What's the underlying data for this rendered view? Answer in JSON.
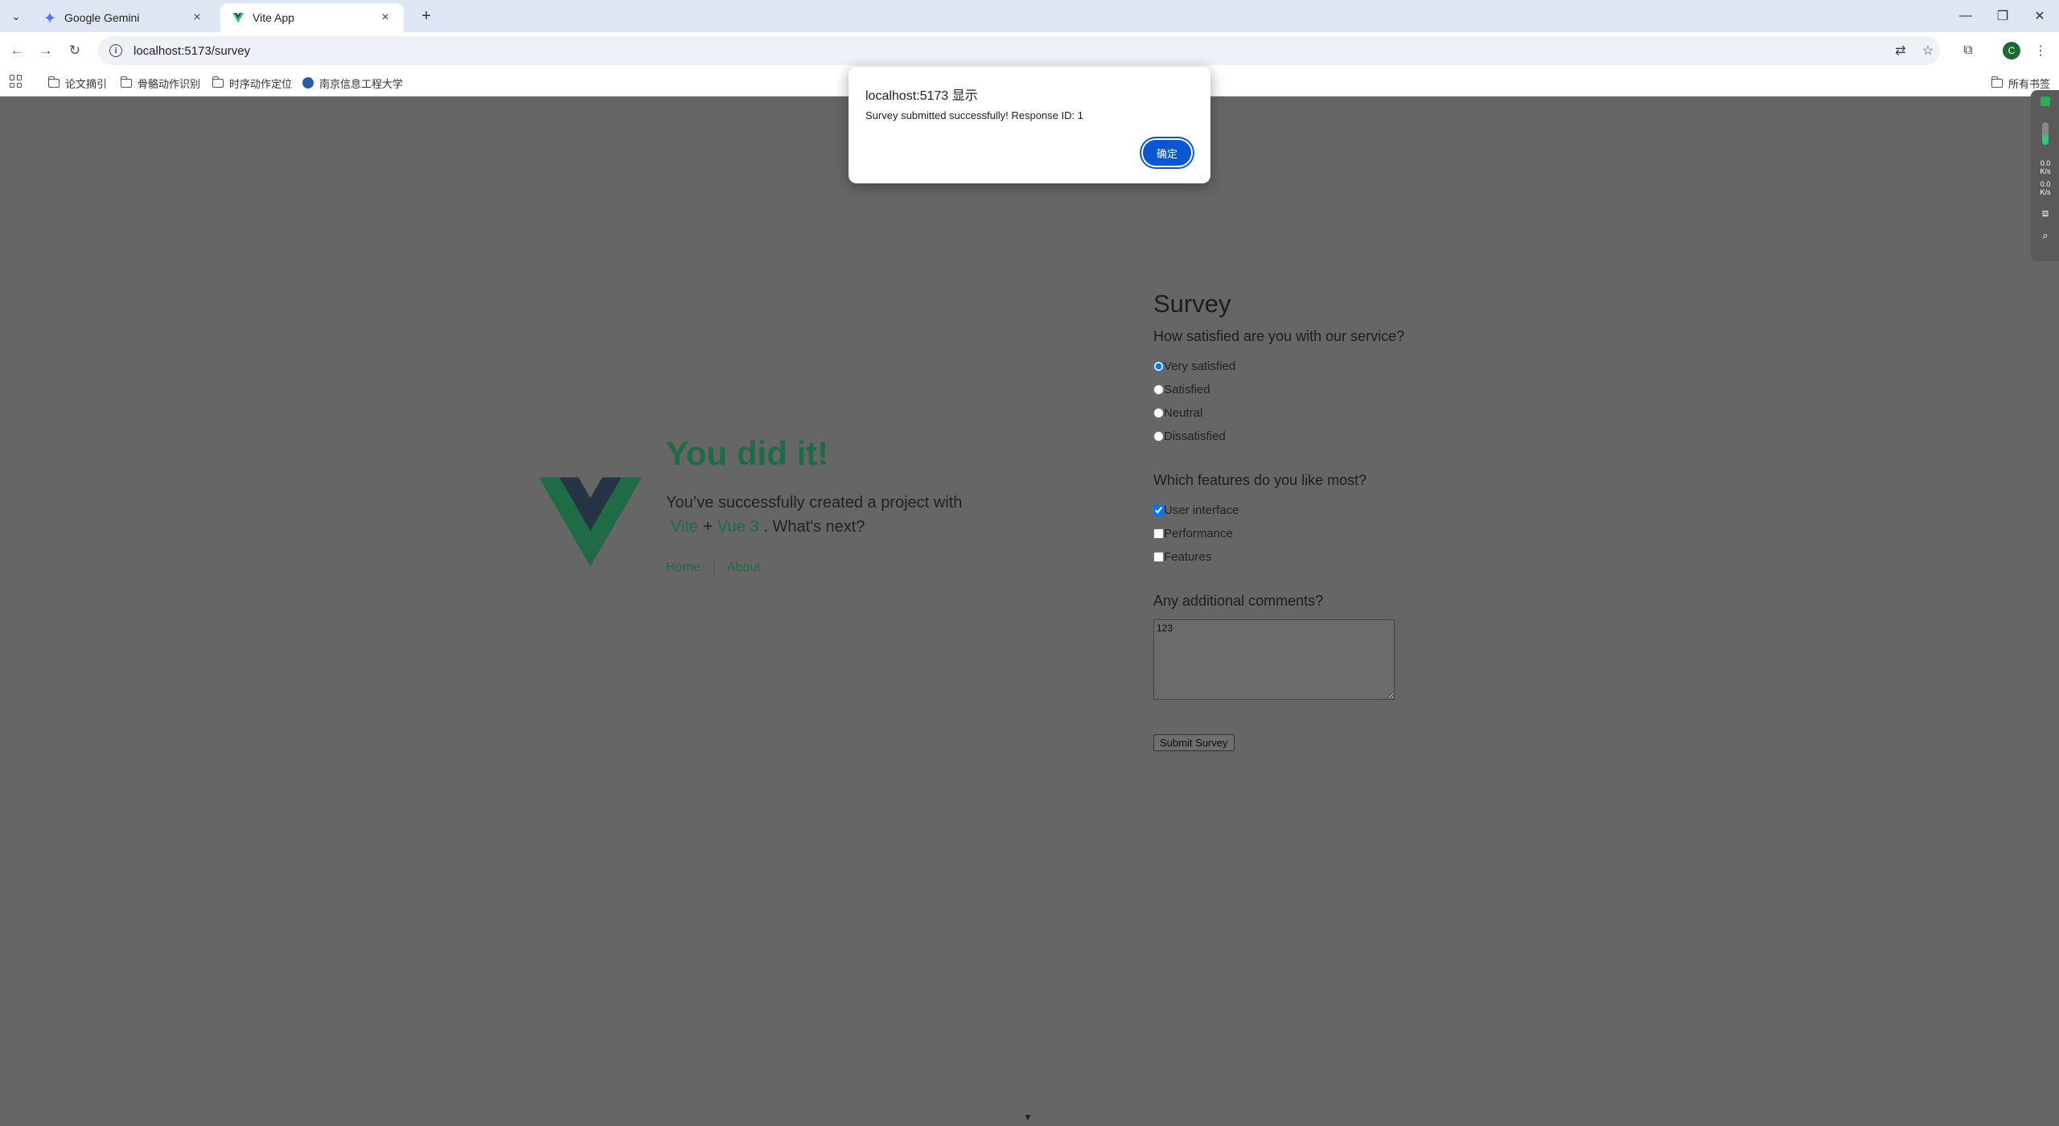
{
  "browser": {
    "tabs": [
      {
        "title": "Google Gemini",
        "active": false
      },
      {
        "title": "Vite App",
        "active": true
      }
    ],
    "url": "localhost:5173/survey",
    "profile_initial": "C",
    "bookmarks": [
      "论文摘引",
      "骨骼动作识别",
      "时序动作定位",
      "南京信息工程大学"
    ],
    "all_bookmarks_label": "所有书签"
  },
  "page": {
    "greeting": {
      "title": "You did it!",
      "text_before": "You’ve successfully created a project with",
      "link1": "Vite",
      "plus": "+",
      "link2": "Vue 3",
      "text_after": ". What's next?"
    },
    "nav": {
      "home": "Home",
      "about": "About"
    },
    "survey": {
      "title": "Survey",
      "q1": "How satisfied are you with our service?",
      "q1_options": [
        "Very satisfied",
        "Satisfied",
        "Neutral",
        "Dissatisfied"
      ],
      "q1_selected": "Very satisfied",
      "q2": "Which features do you like most?",
      "q2_options": [
        "User interface",
        "Performance",
        "Features"
      ],
      "q2_checked": [
        "User interface"
      ],
      "q3": "Any additional comments?",
      "comments_value": "123",
      "submit_label": "Submit Survey"
    },
    "side_panel": {
      "speed_up": "0.0",
      "speed_up_unit": "K/s",
      "speed_down": "0.0",
      "speed_down_unit": "K/s"
    }
  },
  "dialog": {
    "title": "localhost:5173 显示",
    "message": "Survey submitted successfully! Response ID: 1",
    "ok_label": "确定"
  },
  "colors": {
    "overlay_page": "#666666",
    "vue_green": "#1f6b47",
    "dialog_button": "#0b57d0"
  }
}
